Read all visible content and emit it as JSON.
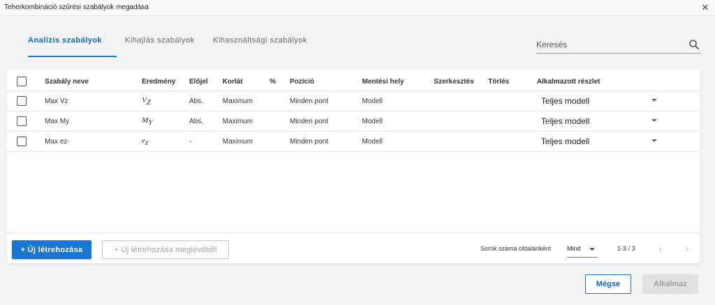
{
  "window": {
    "title": "Teherkombináció szűrési szabályok megadása"
  },
  "tabs": [
    {
      "label": "Analízis szabályok",
      "active": true
    },
    {
      "label": "Kihajlás szabályok",
      "active": false
    },
    {
      "label": "Kihasználtsági szabályok",
      "active": false
    }
  ],
  "search": {
    "placeholder": "Keresés",
    "icon": "search-icon"
  },
  "table": {
    "headers": {
      "name": "Szabály neve",
      "result": "Eredmény",
      "sign": "Előjel",
      "limit": "Korlát",
      "percent": "%",
      "position": "Pozíció",
      "save_location": "Mentési hely",
      "edit": "Szerkesztés",
      "delete": "Törlés",
      "applied_part": "Alkalmazott részlet"
    },
    "rows": [
      {
        "name": "Max Vz",
        "result_base": "V",
        "result_sub": "Z",
        "sign": "Abs.",
        "limit": "Maximum",
        "percent": "",
        "position": "Minden pont",
        "save_location": "Modell",
        "applied_part": "Teljes modell"
      },
      {
        "name": "Max My",
        "result_base": "M",
        "result_sub": "Y",
        "sign": "Abs.",
        "limit": "Maximum",
        "percent": "",
        "position": "Minden pont",
        "save_location": "Modell",
        "applied_part": "Teljes modell"
      },
      {
        "name": "Max ez-",
        "result_base": "e",
        "result_sub": "z",
        "sign": "-",
        "limit": "Maximum",
        "percent": "",
        "position": "Minden pont",
        "save_location": "Modell",
        "applied_part": "Teljes modell"
      }
    ]
  },
  "footer": {
    "create_new": "+ Új létrehozása",
    "create_from_existing": "+ Új létrehozása meglévőből",
    "rows_per_page_label": "Sorok száma oldalanként",
    "rows_per_page_value": "Mind",
    "range": "1-3 / 3",
    "prev": "‹",
    "next": "›"
  },
  "dialog_buttons": {
    "cancel": "Mégse",
    "apply": "Alkalmaz"
  },
  "colors": {
    "accent": "#1976d2",
    "disabled": "#e0e0e0"
  }
}
